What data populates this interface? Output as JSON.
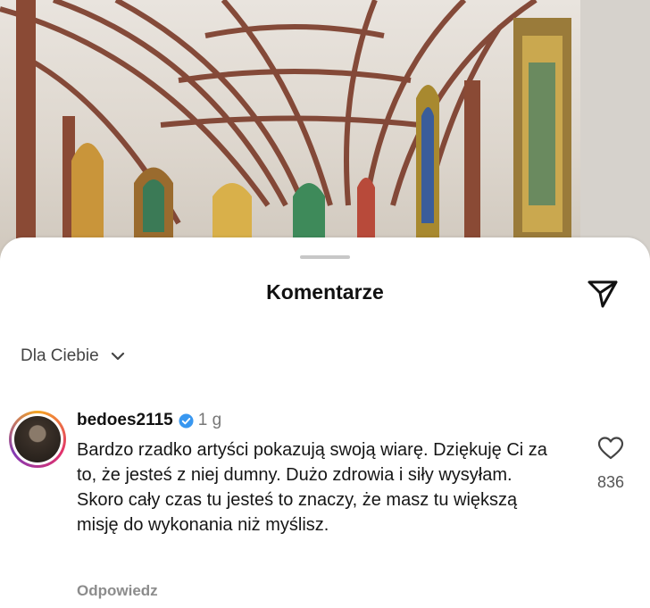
{
  "sheet": {
    "title": "Komentarze",
    "share_icon": "send-icon"
  },
  "filter": {
    "label": "Dla Ciebie",
    "icon": "chevron-down-icon"
  },
  "comment": {
    "username": "bedoes2115",
    "verified": true,
    "time": "1 g",
    "text": "Bardzo rzadko artyści pokazują swoją wiarę. Dziękuję Ci za to, że jesteś z niej dumny. Dużo zdrowia i siły wysyłam. Skoro cały czas tu jesteś to znaczy, że masz tu większą misję do wykonania niż myślisz.",
    "likes": "836",
    "reply_label": "Odpowiedz"
  },
  "colors": {
    "verified_badge": "#3897f0",
    "avatar_ring": "#e1306c"
  }
}
